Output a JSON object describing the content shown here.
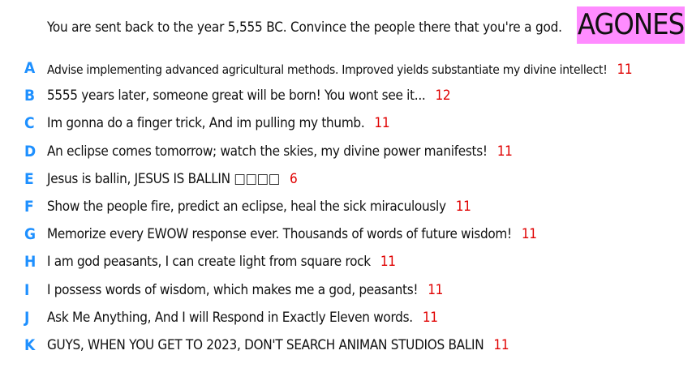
{
  "prompt": "You are sent back to the year 5,555 BC. Convince the people there that you're a god.",
  "logo_text": "AGONES",
  "colors": {
    "logo_bg": "#ff8cff",
    "letter": "#1e90ff",
    "score": "#e00000"
  },
  "answers": [
    {
      "letter": "A",
      "text": "Advise implementing advanced agricultural methods. Improved yields substantiate my divine intellect!",
      "score": "11"
    },
    {
      "letter": "B",
      "text": "5555 years later, someone great will be born! You wont see it...",
      "score": "12"
    },
    {
      "letter": "C",
      "text": "Im gonna do a finger trick, And im pulling my thumb.",
      "score": "11"
    },
    {
      "letter": "D",
      "text": "An eclipse comes tomorrow; watch the skies, my divine power manifests!",
      "score": "11"
    },
    {
      "letter": "E",
      "text": "Jesus is ballin, JESUS IS BALLIN □□□□",
      "score": "6"
    },
    {
      "letter": "F",
      "text": "Show the people fire, predict an eclipse, heal the sick miraculously",
      "score": "11"
    },
    {
      "letter": "G",
      "text": "Memorize every EWOW response ever. Thousands of words of future wisdom!",
      "score": "11"
    },
    {
      "letter": "H",
      "text": "I am god peasants, I can create light from square rock",
      "score": "11"
    },
    {
      "letter": "I",
      "text": "I possess words of wisdom, which makes me a god, peasants!",
      "score": "11"
    },
    {
      "letter": "J",
      "text": "Ask Me Anything, And I will Respond in Exactly Eleven words.",
      "score": "11"
    },
    {
      "letter": "K",
      "text": "GUYS, WHEN YOU GET TO 2023, DON'T SEARCH ANIMAN STUDIOS BALIN",
      "score": "11"
    }
  ]
}
